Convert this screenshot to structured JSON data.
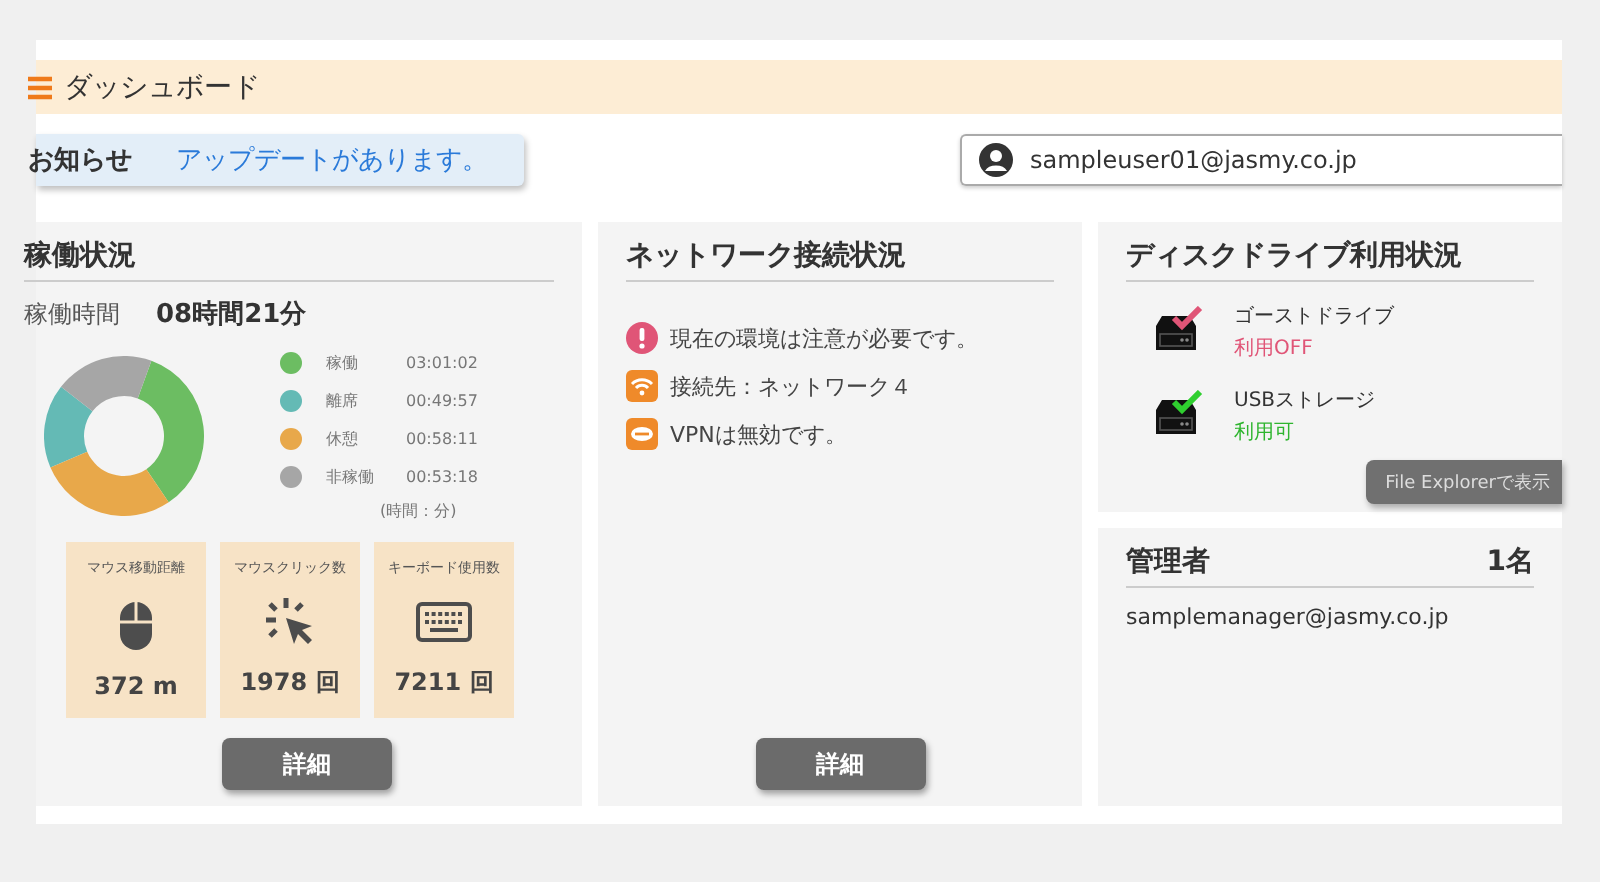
{
  "header": {
    "title": "ダッシュボード"
  },
  "notice": {
    "label": "お知らせ",
    "message": "アップデートがあります。"
  },
  "user": {
    "email": "sampleuser01@jasmy.co.jp"
  },
  "operation": {
    "title": "稼働状況",
    "time_label": "稼働時間",
    "time_value": "08時間21分",
    "legend": [
      {
        "value": "03:01:02",
        "color": "#6cbd62"
      },
      {
        "value": "00:49:57",
        "color": "#64bab5"
      },
      {
        "value": "00:58:11",
        "color": "#e8a84a"
      },
      {
        "value": "00:53:18",
        "color": "#a6a6a6"
      }
    ],
    "unit_note": "(時間：分)",
    "chart_data": {
      "type": "donut",
      "categories": [
        "稼働",
        "離席",
        "休憩",
        "非稼働"
      ],
      "values": [
        35,
        17,
        28,
        20
      ]
    },
    "tiles": [
      {
        "kind": "mouse",
        "label": "マウス移動距離",
        "value": "372 m"
      },
      {
        "kind": "click",
        "label": "マウスクリック数",
        "value": "1978 回"
      },
      {
        "kind": "keyboard",
        "label": "キーボード使用数",
        "value": "7211 回"
      }
    ],
    "button": "詳細"
  },
  "network": {
    "title": "ネットワーク接続状況",
    "items": [
      {
        "kind": "alert",
        "text": "現在の環境は注意が必要です。"
      },
      {
        "kind": "wifi",
        "text": "接続先：ネットワーク４"
      },
      {
        "kind": "vpn",
        "text": "VPNは無効です。"
      }
    ],
    "button": "詳細"
  },
  "disk": {
    "title": "ディスクドライブ利用状況",
    "drives": [
      {
        "name": "ゴーストドライブ",
        "status": "利用OFF",
        "enabled": false
      },
      {
        "name": "USBストレージ",
        "status": "利用可",
        "enabled": true
      }
    ],
    "button": "File Explorerで表示"
  },
  "admin": {
    "title": "管理者",
    "count": "1名",
    "email": "samplemanager@jasmy.co.jp"
  }
}
